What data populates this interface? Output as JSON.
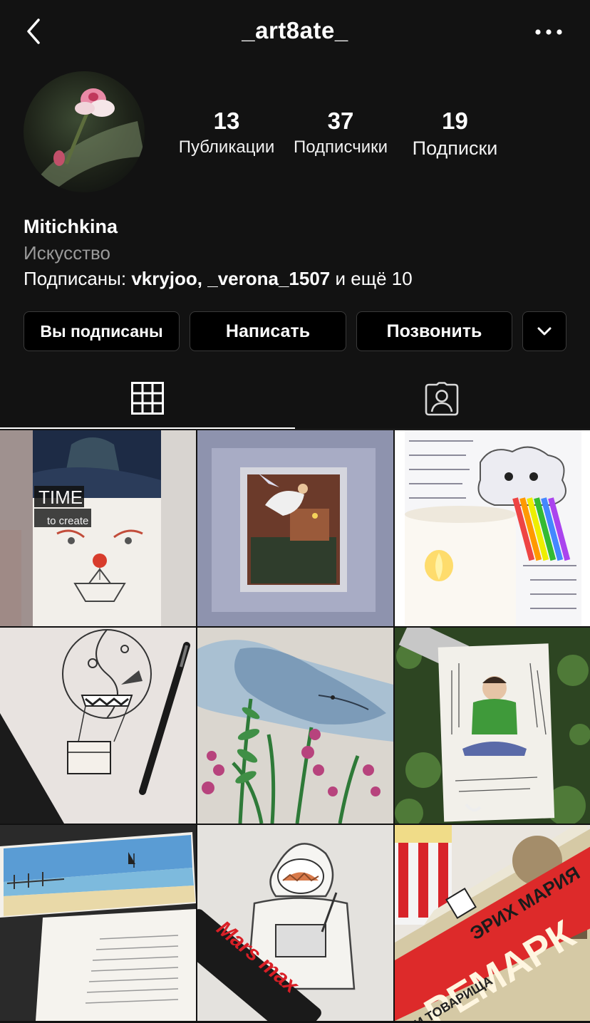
{
  "header": {
    "username": "_art8ate_",
    "back_icon": "chevron-left-icon",
    "more_icon": "ellipsis-icon"
  },
  "profile": {
    "stats": [
      {
        "value": "13",
        "label": "Публикации"
      },
      {
        "value": "37",
        "label": "Подписчики"
      },
      {
        "value": "19",
        "label": "Подписки"
      }
    ],
    "name": "Mitichkina",
    "category": "Искусство",
    "followed_prefix": "Подписаны: ",
    "followed_names": "vkryjoo, _verona_1507",
    "followed_suffix": " и ещё 10"
  },
  "actions": {
    "following_label": "Вы подписаны",
    "message_label": "Написать",
    "call_label": "Позвонить",
    "dropdown_icon": "chevron-down-icon"
  },
  "tabs": [
    {
      "icon": "grid-icon",
      "active": true
    },
    {
      "icon": "tagged-person-icon",
      "active": false
    }
  ],
  "posts": [
    {
      "caption_line1": "TIME",
      "caption_line2": "to create"
    },
    {},
    {},
    {},
    {},
    {},
    {},
    {
      "label": "Mars max"
    },
    {
      "title_line1": "ЭРИХ МАРИЯ",
      "title_line2": "РЕМАРК",
      "subtitle": "ТРИ ТОВАРИЩА"
    }
  ]
}
